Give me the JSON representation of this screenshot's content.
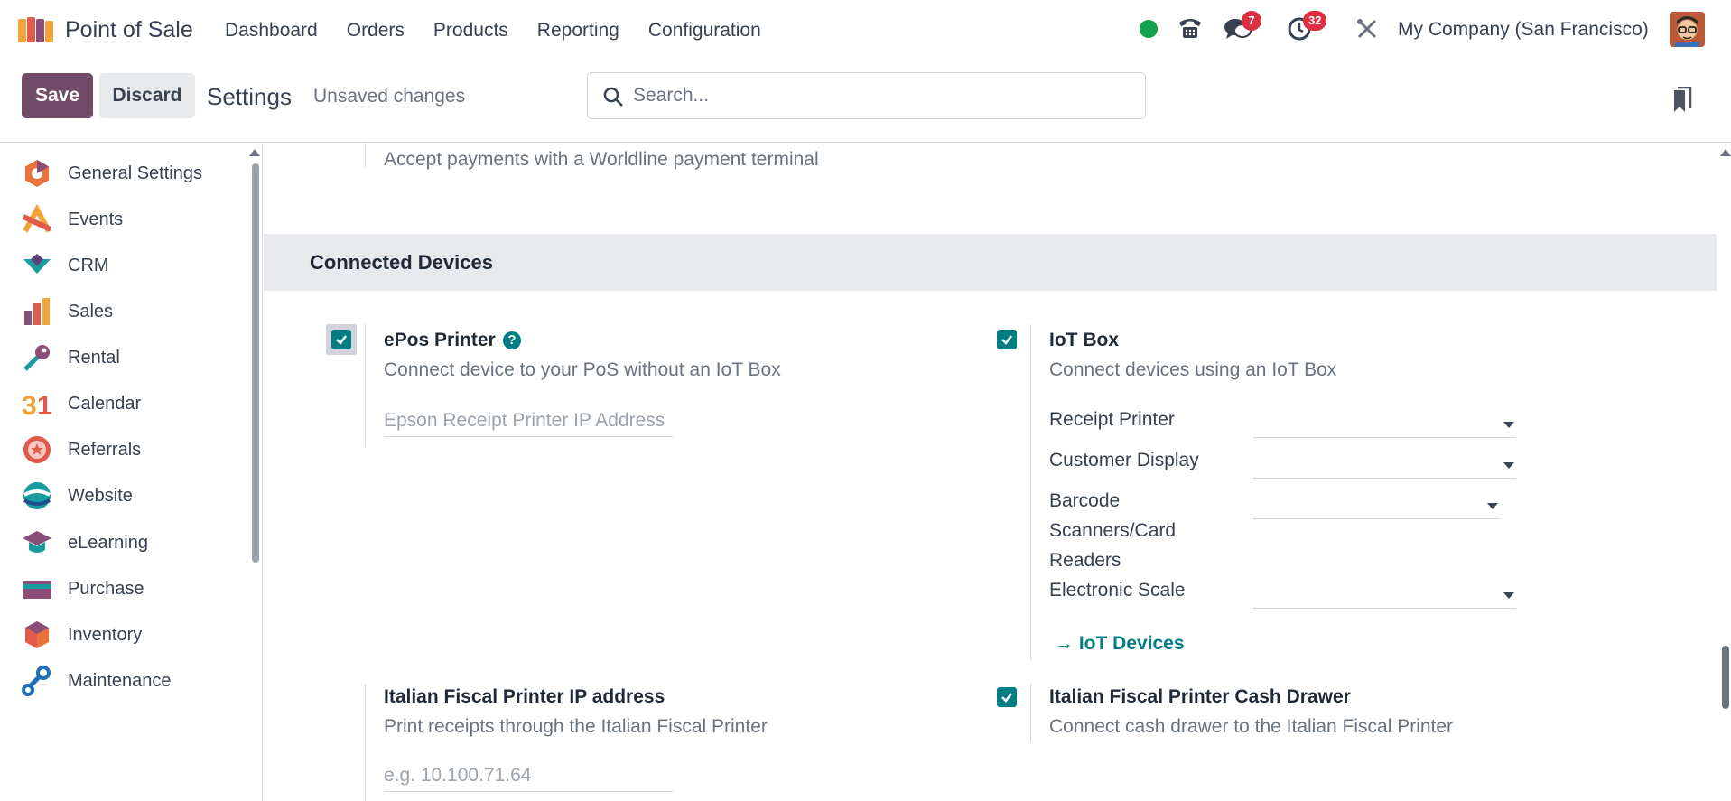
{
  "navbar": {
    "app_name": "Point of Sale",
    "menu": [
      "Dashboard",
      "Orders",
      "Products",
      "Reporting",
      "Configuration"
    ],
    "chat_badge": "7",
    "activity_badge": "32",
    "company": "My Company (San Francisco)",
    "status_color": "#10a34a"
  },
  "control": {
    "save_label": "Save",
    "discard_label": "Discard",
    "title": "Settings",
    "status": "Unsaved changes",
    "search_placeholder": "Search..."
  },
  "sidebar": {
    "items": [
      {
        "label": "General Settings",
        "icon": "general-settings-icon"
      },
      {
        "label": "Events",
        "icon": "events-icon"
      },
      {
        "label": "CRM",
        "icon": "crm-icon"
      },
      {
        "label": "Sales",
        "icon": "sales-icon"
      },
      {
        "label": "Rental",
        "icon": "rental-icon"
      },
      {
        "label": "Calendar",
        "icon": "calendar-icon"
      },
      {
        "label": "Referrals",
        "icon": "referrals-icon"
      },
      {
        "label": "Website",
        "icon": "website-icon"
      },
      {
        "label": "eLearning",
        "icon": "elearning-icon"
      },
      {
        "label": "Purchase",
        "icon": "purchase-icon"
      },
      {
        "label": "Inventory",
        "icon": "inventory-icon"
      },
      {
        "label": "Maintenance",
        "icon": "maintenance-icon"
      }
    ]
  },
  "main": {
    "worldline_desc": "Accept payments with a Worldline payment terminal",
    "section_title": "Connected Devices",
    "epos": {
      "title": "ePos Printer",
      "desc": "Connect device to your PoS without an IoT Box",
      "ip_placeholder": "Epson Receipt Printer IP Address",
      "checked": true
    },
    "iot": {
      "title": "IoT Box",
      "desc": "Connect devices using an IoT Box",
      "checked": true,
      "fields": {
        "receipt_printer": "Receipt Printer",
        "customer_display": "Customer Display",
        "barcode_line1": "Barcode",
        "barcode_line2": "Scanners/Card",
        "barcode_line3": "Readers",
        "electronic_scale": "Electronic Scale"
      },
      "link_label": "IoT Devices"
    },
    "italian_ip": {
      "title": "Italian Fiscal Printer IP address",
      "desc": "Print receipts through the Italian Fiscal Printer",
      "placeholder": "e.g. 10.100.71.64"
    },
    "italian_drawer": {
      "title": "Italian Fiscal Printer Cash Drawer",
      "desc": "Connect cash drawer to the Italian Fiscal Printer",
      "checked": true
    }
  }
}
